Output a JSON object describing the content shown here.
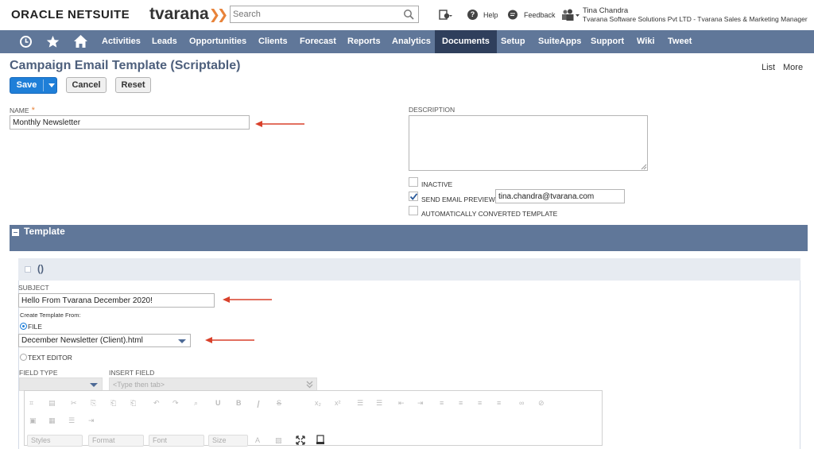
{
  "header": {
    "brand": "ORACLE NETSUITE",
    "company_logo": "tvarana",
    "search": {
      "placeholder": "Search",
      "icon": "search-icon"
    },
    "help_label": "Help",
    "feedback_label": "Feedback",
    "user_name": "Tina Chandra",
    "user_role": "Tvarana Software Solutions Pvt LTD - Tvarana Sales & Marketing Manager"
  },
  "nav": {
    "items": [
      "Activities",
      "Leads",
      "Opportunities",
      "Clients",
      "Forecast",
      "Reports",
      "Analytics",
      "Documents",
      "Setup",
      "SuiteApps",
      "Support",
      "Wiki",
      "Tweet"
    ],
    "active": "Documents"
  },
  "page": {
    "title": "Campaign Email Template (Scriptable)",
    "list_link": "List",
    "more_link": "More"
  },
  "buttons": {
    "save": "Save",
    "cancel": "Cancel",
    "reset": "Reset"
  },
  "form": {
    "name_label": "NAME",
    "name_value": "Monthly Newsletter",
    "description_label": "DESCRIPTION",
    "description_value": "",
    "inactive_label": "INACTIVE",
    "inactive_checked": false,
    "send_preview_label": "SEND EMAIL PREVIEW",
    "send_preview_checked": true,
    "preview_email": "tina.chandra@tvarana.com",
    "auto_converted_label": "AUTOMATICALLY CONVERTED TEMPLATE",
    "auto_converted_checked": false
  },
  "template_section": {
    "title": "Template",
    "subsection_title": "()",
    "subject_label": "SUBJECT",
    "subject_value": "Hello From Tvarana December 2020!",
    "create_from_label": "Create Template From:",
    "file_option": "FILE",
    "file_selected": true,
    "file_value": "December Newsletter (Client).html",
    "text_editor_option": "TEXT EDITOR",
    "field_type_label": "FIELD TYPE",
    "field_type_value": "",
    "insert_field_label": "INSERT FIELD",
    "insert_field_placeholder": "<Type then tab>"
  },
  "editor_toolbar": {
    "combos": [
      "Styles",
      "Format",
      "Font",
      "Size"
    ]
  },
  "colors": {
    "nav_bg": "#607799",
    "nav_active": "#2f3f5c",
    "save_button": "#1f7fd8",
    "title_color": "#4d5f7c",
    "accent_orange": "#e8833a",
    "annotation_arrow": "#d9412b"
  }
}
